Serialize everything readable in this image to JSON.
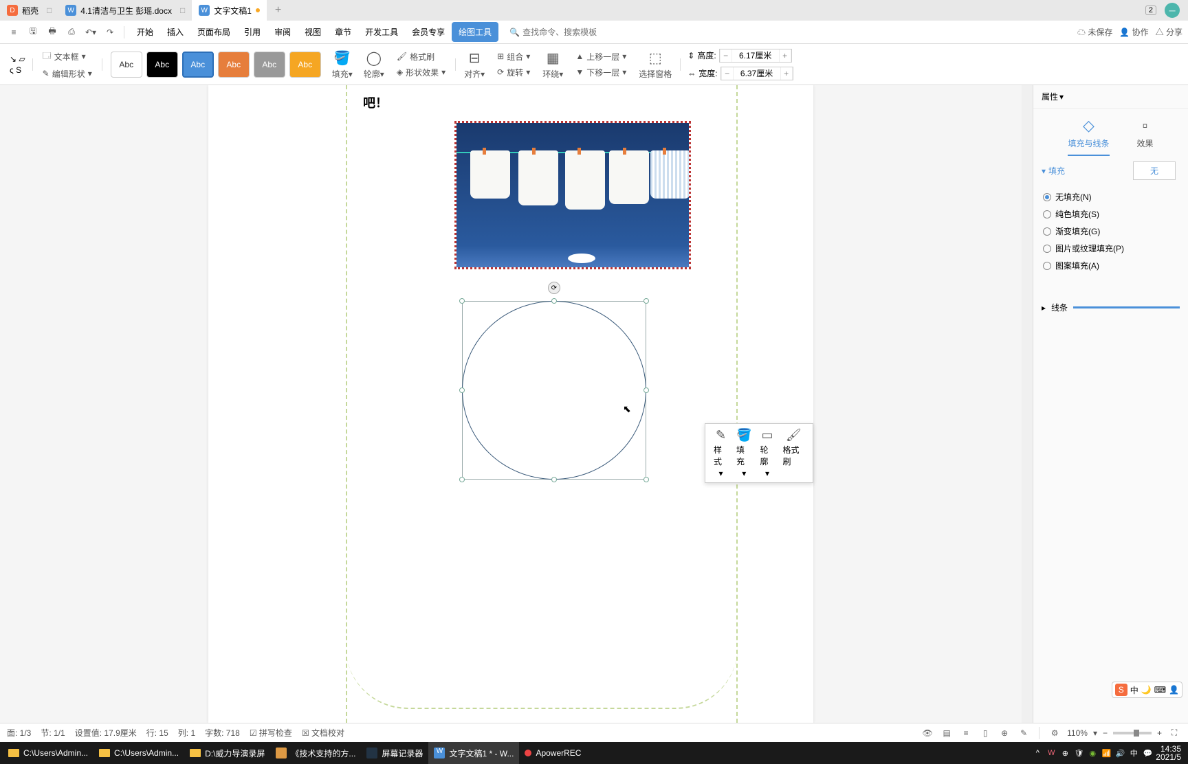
{
  "tabs": [
    {
      "icon": "doc",
      "label": "稻壳",
      "close": "□"
    },
    {
      "icon": "w",
      "label": "4.1清洁与卫生 彭瑶.docx",
      "close": "□"
    },
    {
      "icon": "w",
      "label": "文字文稿1",
      "modified": true
    }
  ],
  "tabbar": {
    "badge": "2"
  },
  "toolbar": {
    "menu": [
      "开始",
      "插入",
      "页面布局",
      "引用",
      "审阅",
      "视图",
      "章节",
      "开发工具",
      "会员专享",
      "绘图工具"
    ],
    "active": 9,
    "search_ph": "查找命令、搜索模板",
    "right": {
      "unsaved": "未保存",
      "collab": "协作",
      "share": "分享"
    }
  },
  "ribbon": {
    "textbox": "文本框",
    "editshape": "编辑形状",
    "styles": [
      "Abc",
      "Abc",
      "Abc",
      "Abc",
      "Abc",
      "Abc"
    ],
    "fill": "填充",
    "outline": "轮廓",
    "shapefx": "形状效果",
    "format_painter": "格式刷",
    "align": "对齐",
    "group": "组合",
    "rotate": "旋转",
    "wrap": "环绕",
    "bring_fwd": "上移一层",
    "send_back": "下移一层",
    "sel_pane": "选择窗格",
    "height_lbl": "高度:",
    "height_val": "6.17厘米",
    "width_lbl": "宽度:",
    "width_val": "6.37厘米"
  },
  "doc": {
    "text": "吧！"
  },
  "float": {
    "style": "样式",
    "fill": "填充",
    "outline": "轮廓",
    "painter": "格式刷"
  },
  "panel": {
    "title": "属性",
    "tabs": {
      "fill_line": "填充与线条",
      "effect": "效果"
    },
    "fill_hdr": "填充",
    "fill_none": "无",
    "radios": {
      "nofill": "无填充(N)",
      "solid": "纯色填充(S)",
      "gradient": "渐变填充(G)",
      "picture": "图片或纹理填充(P)",
      "pattern": "图案填充(A)"
    },
    "line_hdr": "线条"
  },
  "status": {
    "page": "面: 1/3",
    "section": "节: 1/1",
    "setval": "设置值: 17.9厘米",
    "row": "行: 15",
    "col": "列: 1",
    "words": "字数: 718",
    "spell": "拼写检查",
    "proof": "文档校对",
    "zoom": "110%"
  },
  "taskbar": {
    "items": [
      {
        "type": "folder",
        "label": "C:\\Users\\Admin..."
      },
      {
        "type": "folder",
        "label": "C:\\Users\\Admin..."
      },
      {
        "type": "folder",
        "label": "D:\\威力导演录屏"
      },
      {
        "type": "wps",
        "label": "《技术支持的方..."
      },
      {
        "type": "rec",
        "label": "屏幕记录器"
      },
      {
        "type": "w",
        "label": "文字文稿1 * - W...",
        "active": true
      },
      {
        "type": "apow",
        "label": "ApowerREC"
      }
    ],
    "clock": {
      "time": "14:35",
      "date": "2021/5"
    }
  },
  "sogou": {
    "label": "中"
  }
}
